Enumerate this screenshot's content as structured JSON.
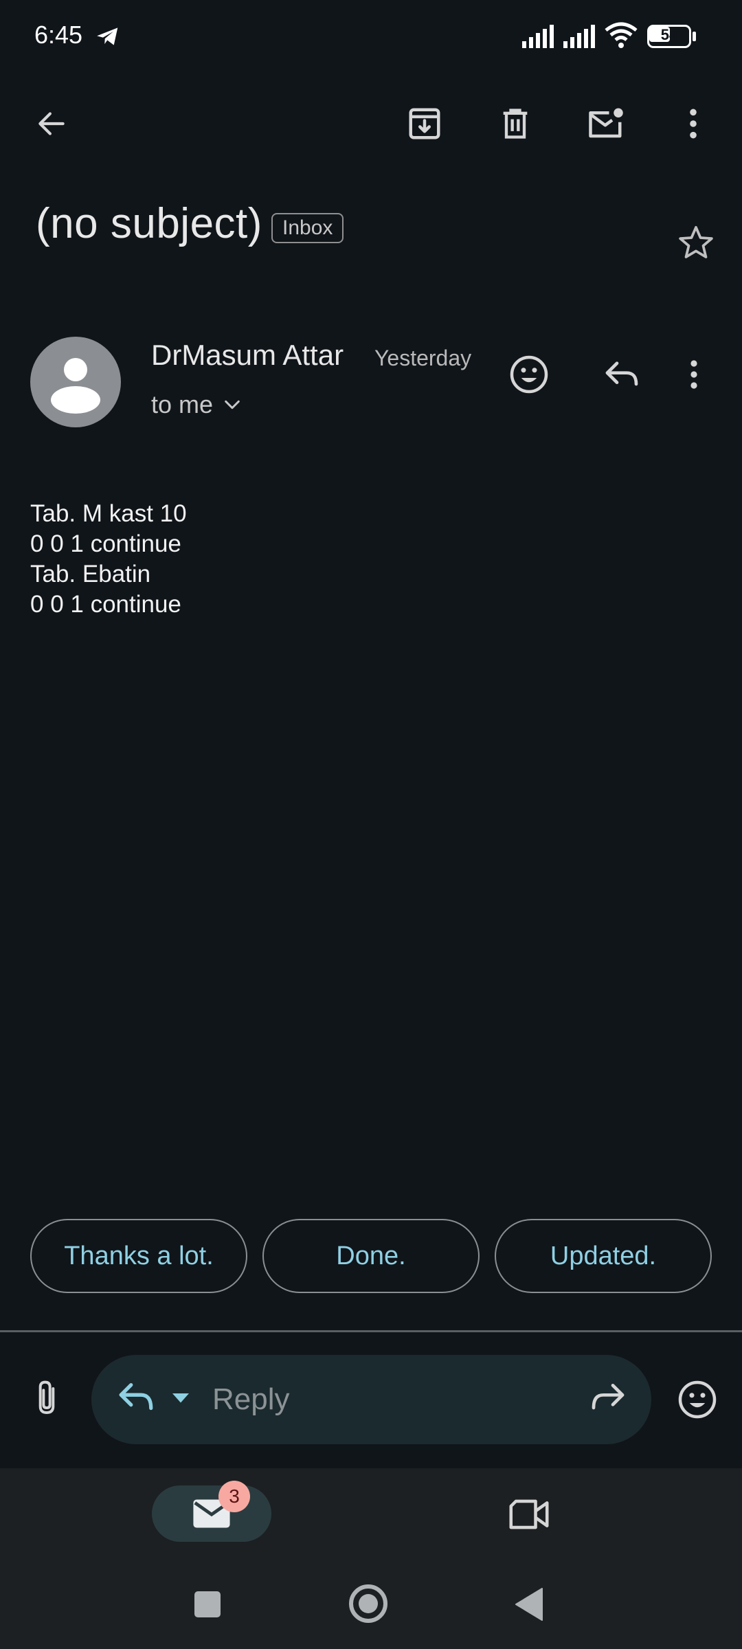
{
  "status_bar": {
    "time": "6:45",
    "battery": "54"
  },
  "top_bar": {
    "icons": [
      "back-arrow-icon",
      "archive-icon",
      "delete-icon",
      "mark-unread-icon",
      "more-vert-icon"
    ]
  },
  "email": {
    "subject": "(no subject)",
    "label": "Inbox",
    "sender": {
      "name": "DrMasum Attar",
      "time": "Yesterday",
      "recipient": "to me"
    },
    "body_lines": [
      "Tab. M kast 10",
      "0 0 1 continue",
      "Tab. Ebatin",
      "0 0 1 continue"
    ]
  },
  "smart_replies": [
    "Thanks a lot.",
    "Done.",
    "Updated."
  ],
  "reply_bar": {
    "placeholder": "Reply"
  },
  "bottom_nav": {
    "mail_badge": "3"
  },
  "colors": {
    "background": "#10151a",
    "accent": "#8fd0e3",
    "badge": "#f7a9a1"
  }
}
